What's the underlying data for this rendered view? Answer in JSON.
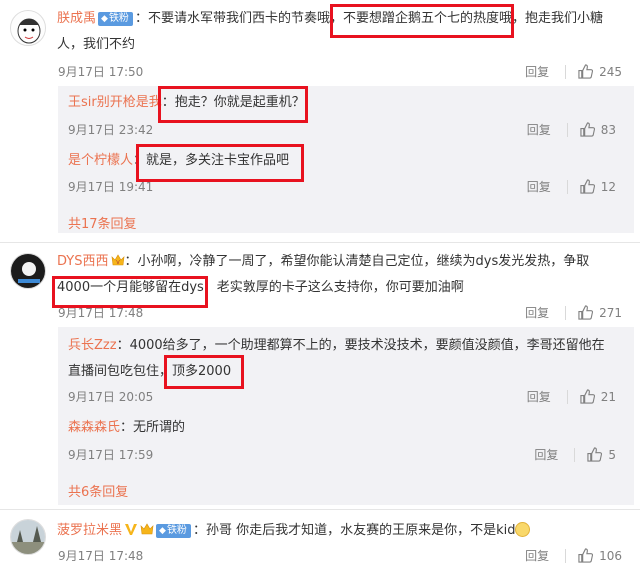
{
  "comments": [
    {
      "user": "朕成禹",
      "badge": "铁粉",
      "text_lines": [
        "：不要请水军带我们西卡的节奏哦，不要想蹭企鹅五个七的热度哦，抱走我们小糖",
        "人，我们不约"
      ],
      "time": "9月17日 17:50",
      "reply_label": "回复",
      "likes": "245",
      "replies": [
        {
          "user": "王sir别开枪是我",
          "text": "：抱走？你就是起重机？",
          "time": "9月17日 23:42",
          "reply_label": "回复",
          "likes": "83"
        },
        {
          "user": "是个柠檬人",
          "text": "：就是，多关注卡宝作品吧",
          "time": "9月17日 19:41",
          "reply_label": "回复",
          "likes": "12"
        }
      ],
      "more": "共17条回复"
    },
    {
      "user": "DYS西西",
      "text_lines": [
        "：小孙啊，冷静了一周了，希望你能认清楚自己定位，继续为dys发光发热，争取",
        "4000一个月能够留在dys，老实敦厚的卡子这么支持你，你可要加油啊"
      ],
      "time": "9月17日 17:48",
      "reply_label": "回复",
      "likes": "271",
      "replies": [
        {
          "user": "兵长Zzz",
          "text_lines": [
            "：4000给多了，一个助理都算不上的，要技术没技术，要颜值没颜值，李哥还留他在",
            "直播间包吃包住，顶多2000"
          ],
          "time": "9月17日 20:05",
          "reply_label": "回复",
          "likes": "21"
        },
        {
          "user": "森森森氏",
          "text": "：无所谓的",
          "time": "9月17日 17:59",
          "reply_label": "回复",
          "likes": "5"
        }
      ],
      "more": "共6条回复"
    },
    {
      "user": "菠罗拉米黑",
      "badge": "铁粉",
      "text": "：孙哥 你走后我才知道，水友赛的王原来是你，不是kid",
      "time": "9月17日 17:48",
      "reply_label": "回复",
      "likes": "106"
    }
  ],
  "colors": {
    "username": "#eb7350",
    "badge": "#5a9ae0",
    "highlight": "#e8121f",
    "reply_bg": "#f2f2f5"
  },
  "icons": {
    "like": "thumbs-up-icon",
    "vip": "vip-crown-icon",
    "emoji": "smile-emoji-icon"
  }
}
